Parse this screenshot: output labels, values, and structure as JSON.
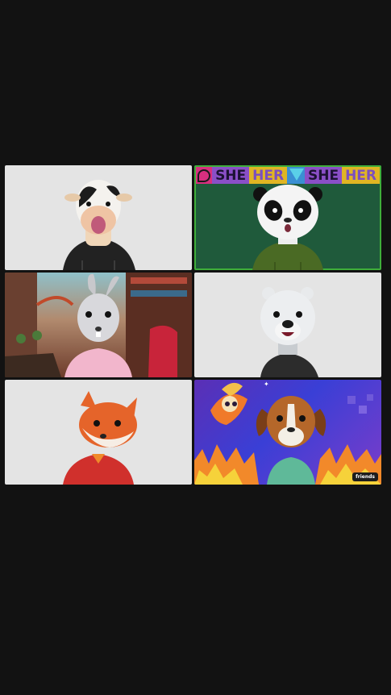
{
  "window": {
    "background_color": "#121212"
  },
  "participants": [
    {
      "id": "p1",
      "avatar": "cow",
      "hoodie_color": "#222222",
      "background": "light-gray"
    },
    {
      "id": "p2",
      "avatar": "panda",
      "hoodie_color": "#4a6a24",
      "background": "green",
      "active_speaker": true,
      "pronoun_banner": {
        "words": [
          "SHE",
          "HER",
          "SHE",
          "HER"
        ]
      }
    },
    {
      "id": "p3",
      "avatar": "rabbit",
      "hoodie_color": "#f2b6cc",
      "background": "room"
    },
    {
      "id": "p4",
      "avatar": "bear",
      "hoodie_color": "#2c2c2c",
      "background": "light-gray"
    },
    {
      "id": "p5",
      "avatar": "fox",
      "hoodie_color": "#d0302c",
      "background": "light-gray"
    },
    {
      "id": "p6",
      "avatar": "dog",
      "hoodie_color": "#5fb999",
      "background": "purple-flames",
      "watermark": "friends"
    }
  ],
  "colors": {
    "active_speaker_border": "#3fae3a",
    "banner_pink": "#d82f7f",
    "banner_purple": "#8a4fc7",
    "banner_yellow": "#e0b523",
    "banner_blue": "#3a8fd3"
  }
}
